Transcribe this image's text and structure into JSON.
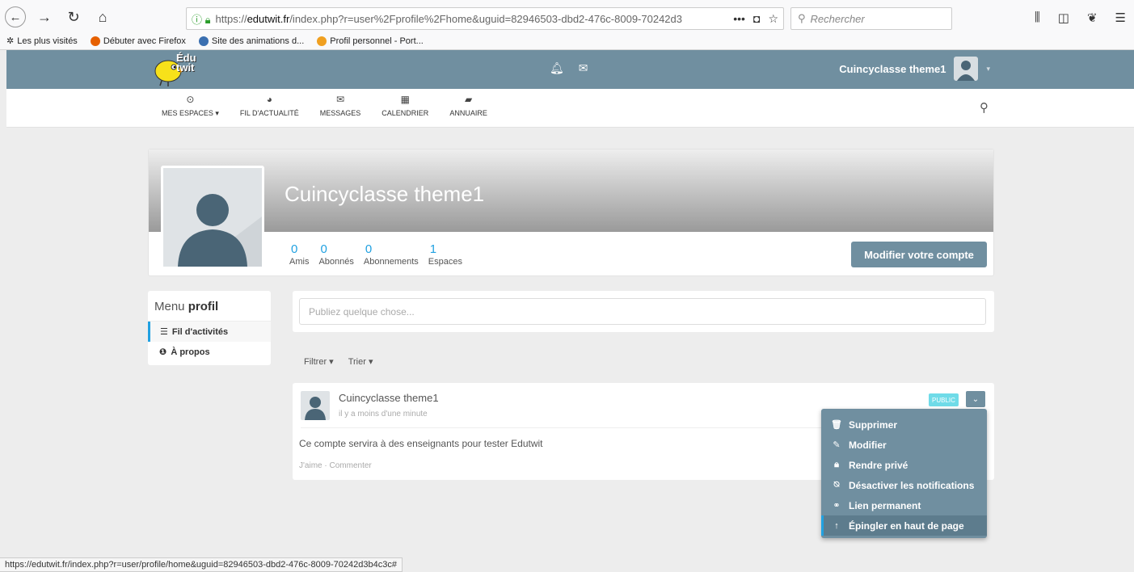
{
  "browser": {
    "url_prefix": "https://",
    "url_domain": "edutwit.fr",
    "url_rest": "/index.php?r=user%2Fprofile%2Fhome&uguid=82946503-dbd2-476c-8009-70242d3",
    "search_placeholder": "Rechercher",
    "bookmarks": [
      {
        "label": "Les plus visités",
        "color": "#888888"
      },
      {
        "label": "Débuter avec Firefox",
        "color": "#e66000"
      },
      {
        "label": "Site des animations d...",
        "color": "#3a6fb0"
      },
      {
        "label": "Profil personnel - Port...",
        "color": "#f0a020"
      }
    ],
    "status_url": "https://edutwit.fr/index.php?r=user/profile/home&uguid=82946503-dbd2-476c-8009-70242d3b4c3c#"
  },
  "appbar": {
    "logo_line1": "Édu",
    "logo_line2": "twit",
    "user_name": "Cuincyclasse theme1",
    "bg_color": "#708fa0"
  },
  "nav": {
    "items": [
      {
        "label": "MES ESPACES ▾",
        "icon": "target-icon"
      },
      {
        "label": "FIL D'ACTUALITÉ",
        "icon": "dashboard-icon"
      },
      {
        "label": "MESSAGES",
        "icon": "envelope-icon"
      },
      {
        "label": "CALENDRIER",
        "icon": "calendar-icon"
      },
      {
        "label": "ANNUAIRE",
        "icon": "book-icon"
      }
    ]
  },
  "profile": {
    "name": "Cuincyclasse theme1",
    "stats": [
      {
        "num": "0",
        "label": "Amis"
      },
      {
        "num": "0",
        "label": "Abonnés"
      },
      {
        "num": "0",
        "label": "Abonnements"
      },
      {
        "num": "1",
        "label": "Espaces"
      }
    ],
    "edit_button": "Modifier votre compte"
  },
  "side_menu": {
    "title_prefix": "Menu",
    "title_bold": "profil",
    "items": [
      {
        "label": "Fil d'activités",
        "icon": "list-icon"
      },
      {
        "label": "À propos",
        "icon": "info-icon"
      }
    ]
  },
  "composer": {
    "placeholder": "Publiez quelque chose..."
  },
  "filters": {
    "filter_label": "Filtrer ▾",
    "sort_label": "Trier ▾"
  },
  "post": {
    "author": "Cuincyclasse theme1",
    "time": "il y a moins d'une minute",
    "body": "Ce compte servira à des enseignants pour tester Edutwit",
    "like": "J'aime",
    "separator": "·",
    "comment": "Commenter",
    "badge": "PUBLIC"
  },
  "dropdown": {
    "items": [
      {
        "label": "Supprimer",
        "icon": "trash-icon"
      },
      {
        "label": "Modifier",
        "icon": "pencil-icon"
      },
      {
        "label": "Rendre privé",
        "icon": "lock-icon"
      },
      {
        "label": "Désactiver les notifications",
        "icon": "bell-slash-icon"
      },
      {
        "label": "Lien permanent",
        "icon": "link-icon"
      },
      {
        "label": "Épingler en haut de page",
        "icon": "arrow-up-icon"
      }
    ]
  }
}
